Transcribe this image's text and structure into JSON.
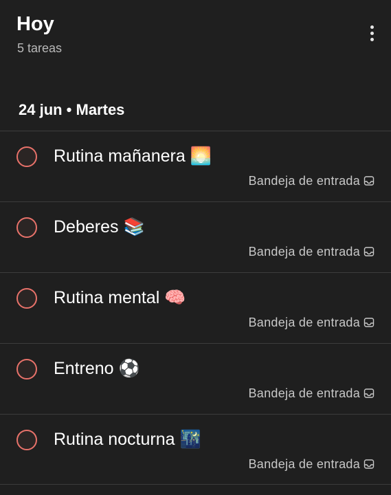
{
  "header": {
    "title": "Hoy",
    "subtitle": "5 tareas",
    "menu_icon": "more-vert-icon"
  },
  "section": {
    "title": "24 jun • Martes"
  },
  "colors": {
    "background": "#1f1f1f",
    "checkbox_ring": "#e8726a",
    "divider": "#3d3d3d",
    "secondary_text": "#b8b8b8"
  },
  "tasks": [
    {
      "name": "Rutina mañanera 🌅",
      "project": "Bandeja de entrada",
      "project_icon": "inbox-icon"
    },
    {
      "name": "Deberes 📚",
      "project": "Bandeja de entrada",
      "project_icon": "inbox-icon"
    },
    {
      "name": "Rutina mental 🧠",
      "project": "Bandeja de entrada",
      "project_icon": "inbox-icon"
    },
    {
      "name": "Entreno ⚽",
      "project": "Bandeja de entrada",
      "project_icon": "inbox-icon"
    },
    {
      "name": "Rutina nocturna 🌃",
      "project": "Bandeja de entrada",
      "project_icon": "inbox-icon"
    }
  ]
}
